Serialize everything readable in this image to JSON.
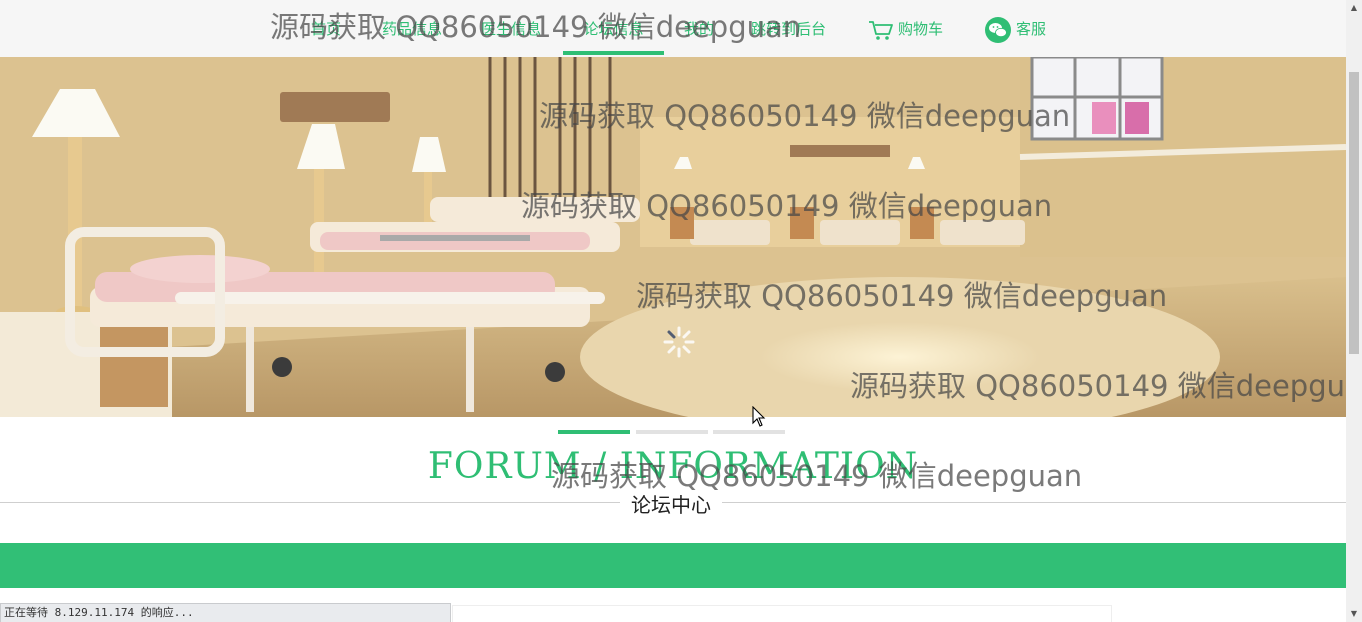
{
  "nav": {
    "items": [
      {
        "label": "首页"
      },
      {
        "label": "药品信息"
      },
      {
        "label": "医生信息"
      },
      {
        "label": "论坛信息",
        "active": true
      },
      {
        "label": "我的"
      },
      {
        "label": "跳转到后台"
      },
      {
        "label": "购物车",
        "icon": "cart-icon"
      },
      {
        "label": "客服",
        "icon": "wechat-icon"
      }
    ]
  },
  "banner": {
    "slide_count": 3,
    "active_slide": 1
  },
  "section": {
    "title_en": "FORUM / INFORMATION",
    "title_cn": "论坛中心"
  },
  "watermark": "源码获取 QQ86050149 微信deepguan",
  "status_bar": "正在等待 8.129.11.174 的响应...",
  "colors": {
    "accent": "#2fbe74",
    "bar": "#31bf76"
  }
}
